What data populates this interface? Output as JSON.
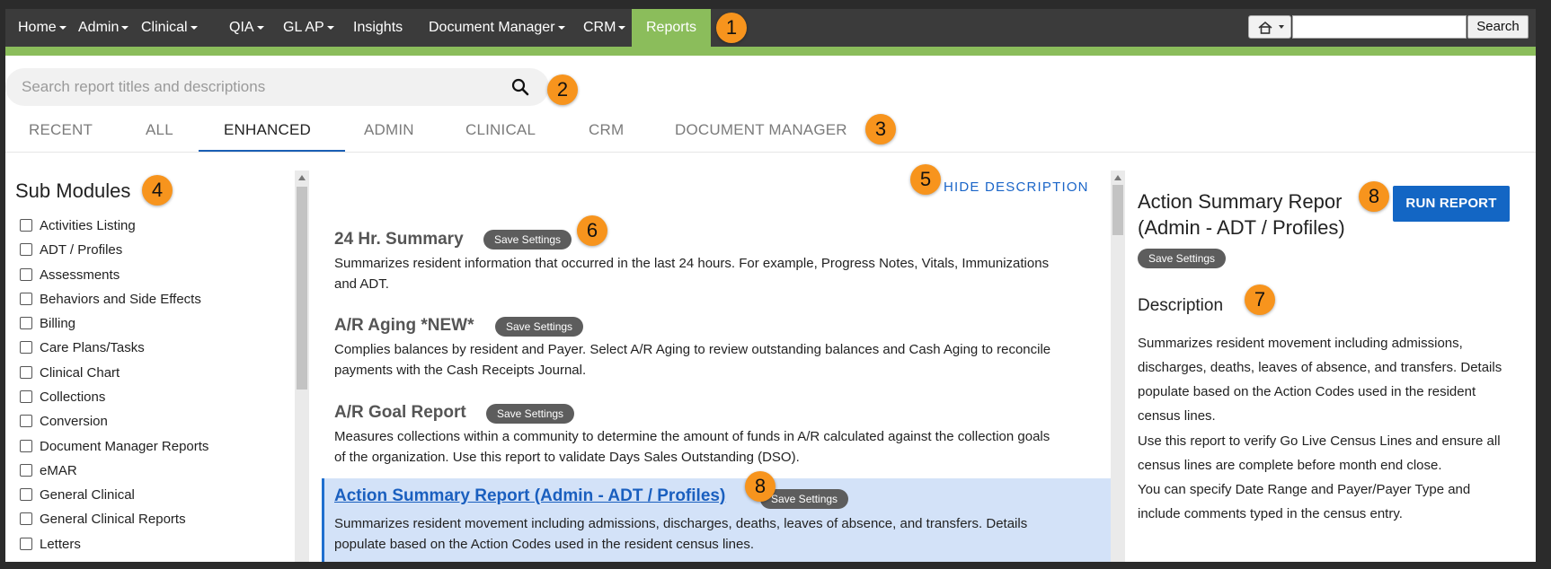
{
  "nav": {
    "items": [
      {
        "label": "Home",
        "caret": true
      },
      {
        "label": "Admin",
        "caret": true
      },
      {
        "label": "Clinical",
        "caret": true
      },
      {
        "label": "QIA",
        "caret": true
      },
      {
        "label": "GL AP",
        "caret": true
      },
      {
        "label": "Insights",
        "caret": false
      },
      {
        "label": "Document Manager",
        "caret": true
      },
      {
        "label": "CRM",
        "caret": true
      },
      {
        "label": "Reports",
        "caret": false,
        "active": true
      }
    ],
    "search_button": "Search",
    "home_icon": "home-icon"
  },
  "search": {
    "placeholder": "Search report titles and descriptions",
    "icon": "search-icon"
  },
  "tabs": [
    "RECENT",
    "ALL",
    "ENHANCED",
    "ADMIN",
    "CLINICAL",
    "CRM",
    "DOCUMENT MANAGER"
  ],
  "active_tab": "ENHANCED",
  "sub_modules": {
    "title": "Sub Modules",
    "items": [
      "Activities Listing",
      "ADT / Profiles",
      "Assessments",
      "Behaviors and Side Effects",
      "Billing",
      "Care Plans/Tasks",
      "Clinical Chart",
      "Collections",
      "Conversion",
      "Document Manager Reports",
      "eMAR",
      "General Clinical",
      "General Clinical Reports",
      "Letters"
    ]
  },
  "reports": {
    "hide_description": "HIDE DESCRIPTION",
    "save_label": "Save Settings",
    "list": [
      {
        "title": "24 Hr. Summary",
        "desc1": "Summarizes resident information that occurred in the last 24 hours. For example, Progress Notes, Vitals, Immunizations",
        "desc2": "and ADT."
      },
      {
        "title": "A/R Aging *NEW*",
        "desc1": "Complies balances by resident and Payer. Select A/R Aging to review outstanding balances and Cash Aging to reconcile",
        "desc2": "payments with the Cash Receipts Journal."
      },
      {
        "title": "A/R Goal Report",
        "desc1": "Measures collections within a community to determine the amount of funds in A/R calculated against the collection goals",
        "desc2": "of the organization. Use this report to validate Days Sales Outstanding (DSO)."
      },
      {
        "title": "Action Summary Report (Admin - ADT / Profiles)",
        "desc1": "Summarizes resident movement including admissions, discharges, deaths, leaves of absence, and transfers. Details",
        "desc2": "populate based on the Action Codes used in the resident census lines.",
        "selected": true
      }
    ]
  },
  "detail": {
    "title_line1": "Action Summary Repor",
    "title_line2": "(Admin - ADT / Profiles)",
    "run_button": "RUN REPORT",
    "save_label": "Save Settings",
    "description_heading": "Description",
    "description_lines": [
      "Summarizes resident movement including admissions,",
      "discharges, deaths, leaves of absence, and transfers. Details",
      "populate based on the Action Codes used in the resident",
      "census lines.",
      "Use this report to verify Go Live Census Lines and ensure all",
      "census lines are complete before month end close.",
      "You can specify Date Range and Payer/Payer Type and",
      "include comments typed in the census entry."
    ]
  },
  "callouts": [
    "1",
    "2",
    "3",
    "4",
    "5",
    "6",
    "7",
    "8",
    "8"
  ],
  "colors": {
    "nav_bg": "#3b3b3b",
    "accent_green": "#8bbd5b",
    "primary_blue": "#1366c4",
    "callout_orange": "#f7941d",
    "selected_row": "#d3e2f8"
  }
}
